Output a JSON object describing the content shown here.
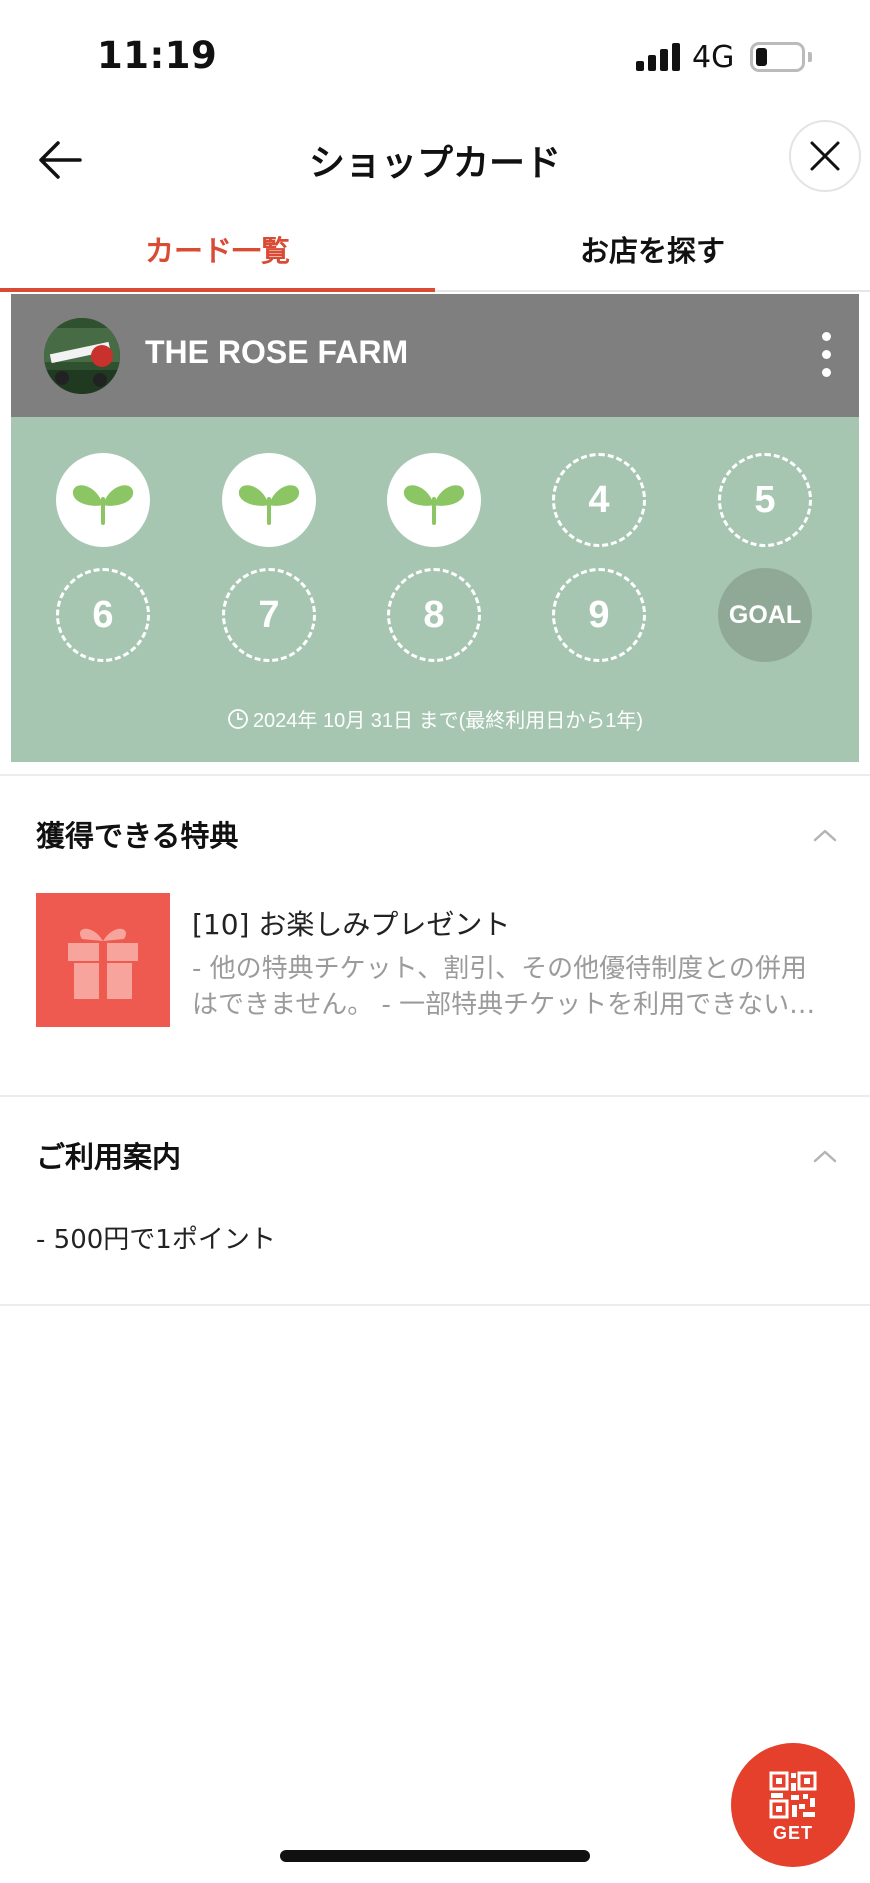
{
  "status_bar": {
    "time": "11:19",
    "network": "4G"
  },
  "header": {
    "title": "ショップカード"
  },
  "tabs": [
    {
      "label": "カード一覧",
      "active": true
    },
    {
      "label": "お店を探す",
      "active": false
    }
  ],
  "card": {
    "shop_name": "THE ROSE FARM",
    "stamps": [
      {
        "label": "",
        "state": "stamped"
      },
      {
        "label": "",
        "state": "stamped"
      },
      {
        "label": "",
        "state": "stamped"
      },
      {
        "label": "4",
        "state": "empty"
      },
      {
        "label": "5",
        "state": "empty"
      },
      {
        "label": "6",
        "state": "empty"
      },
      {
        "label": "7",
        "state": "empty"
      },
      {
        "label": "8",
        "state": "empty"
      },
      {
        "label": "9",
        "state": "empty"
      },
      {
        "label": "GOAL",
        "state": "goal"
      }
    ],
    "expiry": "2024年 10月 31日 まで(最終利用日から1年)",
    "colors": {
      "header": "#7f7f7f",
      "body": "#a6c6b2"
    }
  },
  "benefits": {
    "title": "獲得できる特典",
    "items": [
      {
        "title": "[10] お楽しみプレゼント",
        "desc_line1": "- 他の特典チケット、割引、その他優待制度との併用",
        "desc_line2": "はできません。 - 一部特典チケットを利用できない…"
      }
    ]
  },
  "guide": {
    "title": "ご利用案内",
    "text": "- 500円で1ポイント"
  },
  "fab": {
    "label": "GET"
  },
  "accent_color": "#d94b34"
}
